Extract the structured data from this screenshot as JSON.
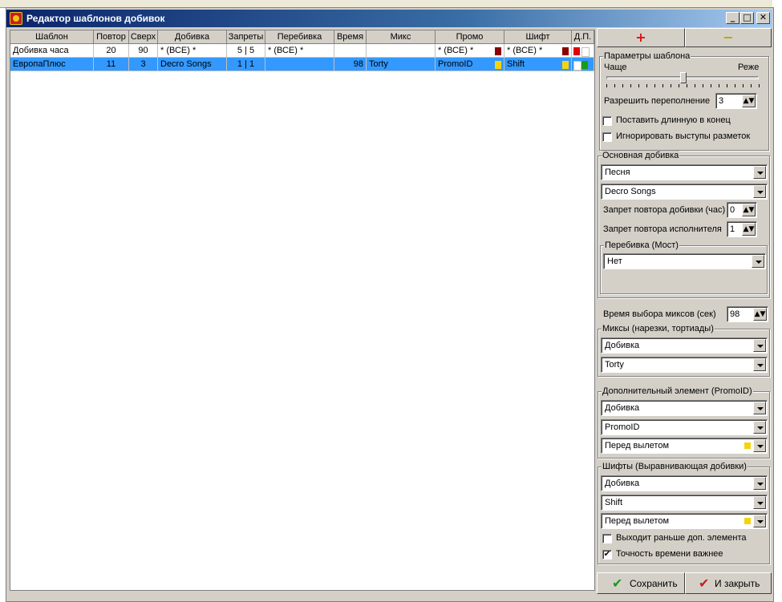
{
  "window": {
    "title": "Редактор шаблонов добивок"
  },
  "titlebar_buttons": {
    "minimize": "_",
    "maximize": "□",
    "close": "✕"
  },
  "grid": {
    "columns": [
      "Шаблон",
      "Повтор",
      "Сверх",
      "Добивка",
      "Запреты",
      "Перебивка",
      "Время",
      "Микс",
      "Промо",
      "Шифт",
      "Д.П."
    ],
    "rows": [
      {
        "template": "Добивка часа",
        "repeat": "20",
        "over": "90",
        "fill": "* (ВСЕ) *",
        "bans": "5 | 5",
        "bridge": "* (ВСЕ) *",
        "time": "",
        "mix": "",
        "promo": "* (ВСЕ) *",
        "promo_color": "#8b0000",
        "shift": "* (ВСЕ) *",
        "shift_color": "#8b0000",
        "dp_colors": [
          "#e00000",
          "#ffffff"
        ]
      },
      {
        "template": "ЕвропаПлюс",
        "repeat": "11",
        "over": "3",
        "fill": "Decro Songs",
        "bans": "1 | 1",
        "bridge": "",
        "time": "98",
        "mix": "Torty",
        "promo": "PromoID",
        "promo_color": "#f5d40f",
        "shift": "Shift",
        "shift_color": "#f5d40f",
        "dp_colors": [
          "#ffffff",
          "#1a9a1a"
        ]
      }
    ]
  },
  "panel": {
    "add_icon": "+",
    "remove_icon": "−",
    "params_group": "Параметры шаблона",
    "slider_left": "Чаще",
    "slider_right": "Реже",
    "slider_level": 0.5,
    "overflow_label": "Разрешить переполнение",
    "overflow_value": "3",
    "long_at_end": "Поставить длинную в конец",
    "ignore_marks": "Игнорировать выступы разметок",
    "main_fill_group": "Основная добивка",
    "main_type": "Песня",
    "main_source": "Decro Songs",
    "fill_ban_label": "Запрет повтора добивки (час)",
    "fill_ban_value": "0",
    "artist_ban_label": "Запрет повтора исполнителя",
    "artist_ban_value": "1",
    "bridge_group": "Перебивка (Мост)",
    "bridge_value": "Нет",
    "mix_time_label": "Время выбора миксов (сек)",
    "mix_time_value": "98",
    "mixes_group": "Миксы (нарезки, тортиады)",
    "mix_type": "Добивка",
    "mix_source": "Torty",
    "promo_group": "Дополнительный элемент (PromoID)",
    "promo_type": "Добивка",
    "promo_source": "PromoID",
    "promo_position": "Перед вылетом",
    "promo_color": "#f5d40f",
    "shifts_group": "Шифты (Выравнивающая добивки)",
    "shift_type": "Добивка",
    "shift_source": "Shift",
    "shift_position": "Перед вылетом",
    "shift_color": "#f5d40f",
    "exit_early": "Выходит раньше доп. элемента",
    "exit_early_checked": false,
    "time_accuracy": "Точность времени важнее",
    "time_accuracy_checked": true,
    "save_label": "Сохранить",
    "close_label": "И закрыть"
  }
}
